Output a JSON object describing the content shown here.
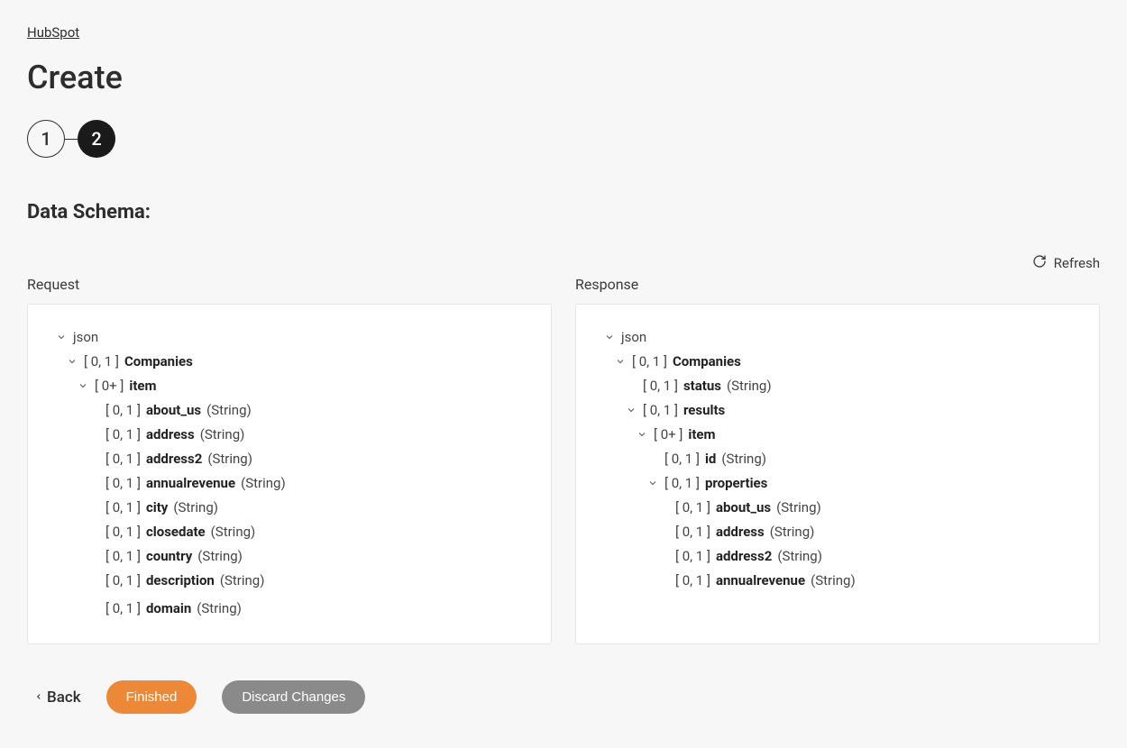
{
  "breadcrumb": "HubSpot",
  "page_title": "Create",
  "stepper": {
    "step1": "1",
    "step2": "2"
  },
  "section_title": "Data Schema:",
  "refresh_label": "Refresh",
  "request_label": "Request",
  "response_label": "Response",
  "footer": {
    "back": "Back",
    "finished": "Finished",
    "discard": "Discard Changes"
  },
  "request_tree": {
    "root": "json",
    "companies": {
      "card": "[ 0, 1 ]",
      "name": "Companies"
    },
    "item": {
      "card": "[ 0+ ]",
      "name": "item"
    },
    "fields": [
      {
        "card": "[ 0, 1 ]",
        "name": "about_us",
        "type": "(String)"
      },
      {
        "card": "[ 0, 1 ]",
        "name": "address",
        "type": "(String)"
      },
      {
        "card": "[ 0, 1 ]",
        "name": "address2",
        "type": "(String)"
      },
      {
        "card": "[ 0, 1 ]",
        "name": "annualrevenue",
        "type": "(String)"
      },
      {
        "card": "[ 0, 1 ]",
        "name": "city",
        "type": "(String)"
      },
      {
        "card": "[ 0, 1 ]",
        "name": "closedate",
        "type": "(String)"
      },
      {
        "card": "[ 0, 1 ]",
        "name": "country",
        "type": "(String)"
      },
      {
        "card": "[ 0, 1 ]",
        "name": "description",
        "type": "(String)"
      },
      {
        "card": "[ 0, 1 ]",
        "name": "domain",
        "type": "(String)"
      }
    ]
  },
  "response_tree": {
    "root": "json",
    "companies": {
      "card": "[ 0, 1 ]",
      "name": "Companies"
    },
    "status": {
      "card": "[ 0, 1 ]",
      "name": "status",
      "type": "(String)"
    },
    "results": {
      "card": "[ 0, 1 ]",
      "name": "results"
    },
    "item": {
      "card": "[ 0+ ]",
      "name": "item"
    },
    "id": {
      "card": "[ 0, 1 ]",
      "name": "id",
      "type": "(String)"
    },
    "properties": {
      "card": "[ 0, 1 ]",
      "name": "properties"
    },
    "fields": [
      {
        "card": "[ 0, 1 ]",
        "name": "about_us",
        "type": "(String)"
      },
      {
        "card": "[ 0, 1 ]",
        "name": "address",
        "type": "(String)"
      },
      {
        "card": "[ 0, 1 ]",
        "name": "address2",
        "type": "(String)"
      },
      {
        "card": "[ 0, 1 ]",
        "name": "annualrevenue",
        "type": "(String)"
      }
    ]
  }
}
